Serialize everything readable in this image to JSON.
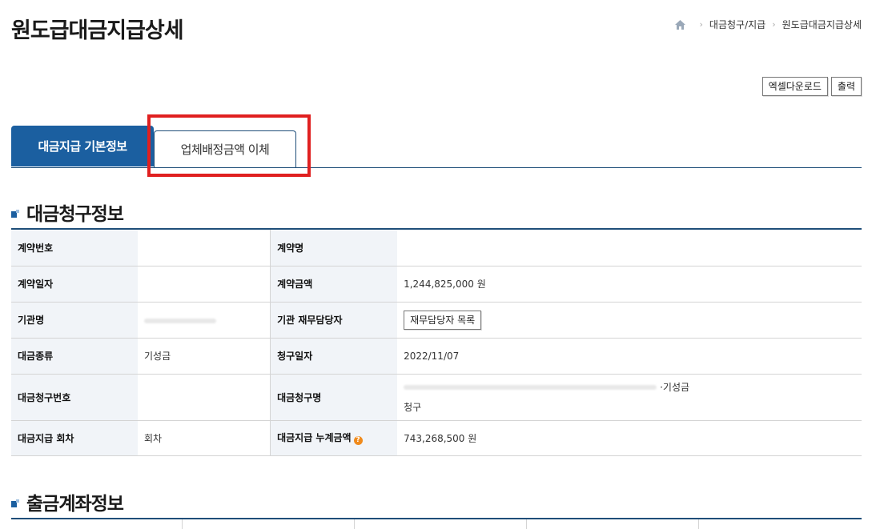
{
  "page": {
    "title": "원도급대금지급상세"
  },
  "breadcrumb": {
    "items": [
      "대금청구/지급",
      "원도급대금지급상세"
    ]
  },
  "toolbar": {
    "excel_label": "엑셀다운로드",
    "print_label": "출력"
  },
  "tabs": {
    "basic_label": "대금지급 기본정보",
    "transfer_label": "업체배정금액 이체"
  },
  "sections": {
    "claim_title": "대금청구정보",
    "account_title": "출금계좌정보"
  },
  "claim": {
    "contract_no_label": "계약번호",
    "contract_no": "",
    "contract_name_label": "계약명",
    "contract_name": "",
    "contract_date_label": "계약일자",
    "contract_date": "",
    "contract_amount_label": "계약금액",
    "contract_amount": "1,244,825,000 원",
    "agency_label": "기관명",
    "agency": "",
    "finance_manager_label": "기관 재무담당자",
    "finance_manager_button": "재무담당자 목록",
    "payment_type_label": "대금종류",
    "payment_type": "기성금",
    "claim_date_label": "청구일자",
    "claim_date": "2022/11/07",
    "claim_no_label": "대금청구번호",
    "claim_no": "",
    "claim_name_label": "대금청구명",
    "claim_name_line1": "·기성금",
    "claim_name_line2": "청구",
    "round_label": "대금지급 회차",
    "round": "회차",
    "cumulative_label": "대금지급 누계금액",
    "cumulative": "743,268,500 원",
    "help_glyph": "?"
  },
  "colors": {
    "primary": "#1b5fa0",
    "header_bg": "#f1f4f8",
    "highlight": "#e02020",
    "help": "#f08a1c"
  }
}
